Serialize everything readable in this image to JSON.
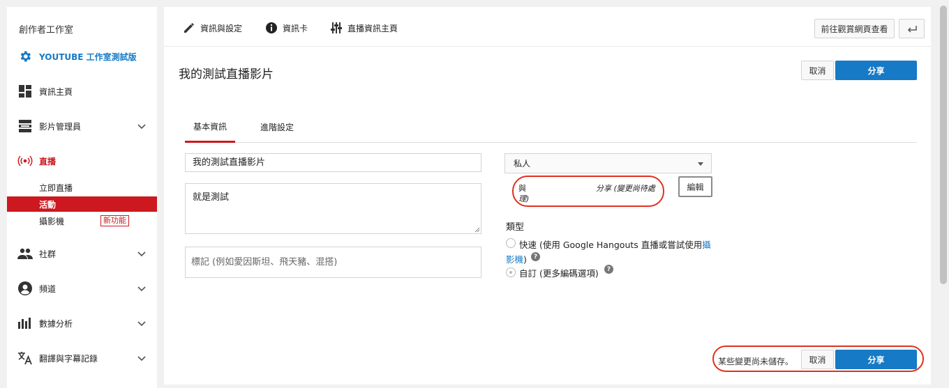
{
  "sidebar": {
    "title": "創作者工作室",
    "studio_beta": "YOUTUBE 工作室測試版",
    "items": [
      {
        "label": "資訊主頁",
        "icon": "dashboard-icon"
      },
      {
        "label": "影片管理員",
        "icon": "video-manager-icon"
      },
      {
        "label": "直播",
        "icon": "live-broadcast-icon"
      },
      {
        "label": "社群",
        "icon": "community-icon"
      },
      {
        "label": "頻道",
        "icon": "channel-icon"
      },
      {
        "label": "數據分析",
        "icon": "analytics-icon"
      },
      {
        "label": "翻譯與字幕記錄",
        "icon": "translate-icon"
      }
    ],
    "live_sub": {
      "stream_now": "立即直播",
      "events": "活動",
      "camera": "攝影機",
      "new_badge": "新功能"
    }
  },
  "topbar": {
    "info_settings": "資訊與設定",
    "cards": "資訊卡",
    "live_dashboard": "直播資訊主頁",
    "view_page": "前往觀賞網頁查看"
  },
  "page": {
    "title": "我的測試直播影片",
    "cancel": "取消",
    "share": "分享"
  },
  "tabs": {
    "basic": "基本資訊",
    "advanced": "進階設定"
  },
  "form": {
    "title_value": "我的測試直播影片",
    "description_value": "就是測試",
    "tags_placeholder": "標記 (例如愛因斯坦、飛天豬、混搭)",
    "privacy_value": "私人",
    "share_note_left": "與",
    "share_note_left2": "理)",
    "share_note_right": "分享 (變更尚待處",
    "edit_button": "編輯",
    "type_title": "類型",
    "quick_label": "快速",
    "quick_desc": " (使用 Google Hangouts 直播或嘗試使用",
    "quick_link_a": "攝",
    "quick_link_b": "影機",
    "quick_close": ")",
    "custom_label": "自訂",
    "custom_desc": " (更多編碼選項)",
    "help_glyph": "?"
  },
  "footer": {
    "unsaved": "某些變更尚未儲存。",
    "cancel": "取消",
    "share": "分享"
  },
  "colors": {
    "accent": "#167ac6",
    "brand_red": "#cc181e",
    "annotation_red": "#e0301e"
  }
}
